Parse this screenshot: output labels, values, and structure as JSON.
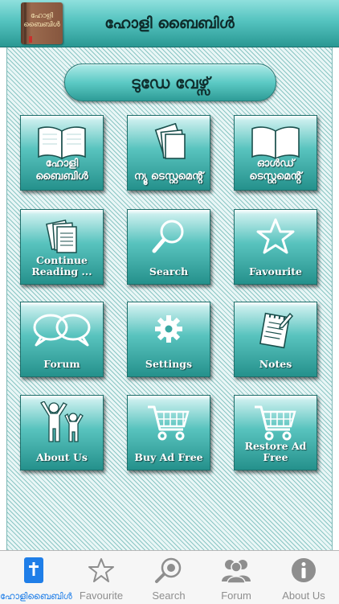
{
  "header": {
    "title": "ഹോളി ബൈബിൾ",
    "logo_text": "ഹോളി ബൈബിൾ"
  },
  "today_verse": {
    "label": "ടുഡേ വേഴ്സ്"
  },
  "tiles": [
    {
      "label": "ഹോളി ബൈബിൾ",
      "icon": "open-book-icon"
    },
    {
      "label": "ന്യൂ ടെസ്റ്റമെൻ്റ്",
      "icon": "pages-icon"
    },
    {
      "label": "ഓൾഡ് ടെസ്റ്റമെൻ്റ്",
      "icon": "open-book-icon"
    },
    {
      "label": "Continue Reading ...",
      "icon": "document-stack-icon"
    },
    {
      "label": "Search",
      "icon": "search-icon"
    },
    {
      "label": "Favourite",
      "icon": "star-icon"
    },
    {
      "label": "Forum",
      "icon": "speech-bubbles-icon"
    },
    {
      "label": "Settings",
      "icon": "gear-icon"
    },
    {
      "label": "Notes",
      "icon": "notepad-icon"
    },
    {
      "label": "About Us",
      "icon": "people-icon"
    },
    {
      "label": "Buy Ad Free",
      "icon": "cart-icon"
    },
    {
      "label": "Restore Ad Free",
      "icon": "cart-icon"
    }
  ],
  "tabbar": {
    "items": [
      {
        "label": "ഹോളിബൈബിൾ",
        "icon": "bible-icon",
        "active": true
      },
      {
        "label": "Favourite",
        "icon": "star-icon",
        "active": false
      },
      {
        "label": "Search",
        "icon": "search-icon",
        "active": false
      },
      {
        "label": "Forum",
        "icon": "people-icon",
        "active": false
      },
      {
        "label": "About Us",
        "icon": "info-icon",
        "active": false
      }
    ]
  },
  "colors": {
    "accent": "#2a9893",
    "tab_active": "#1f7ee8",
    "tab_inactive": "#8e8e8e"
  }
}
